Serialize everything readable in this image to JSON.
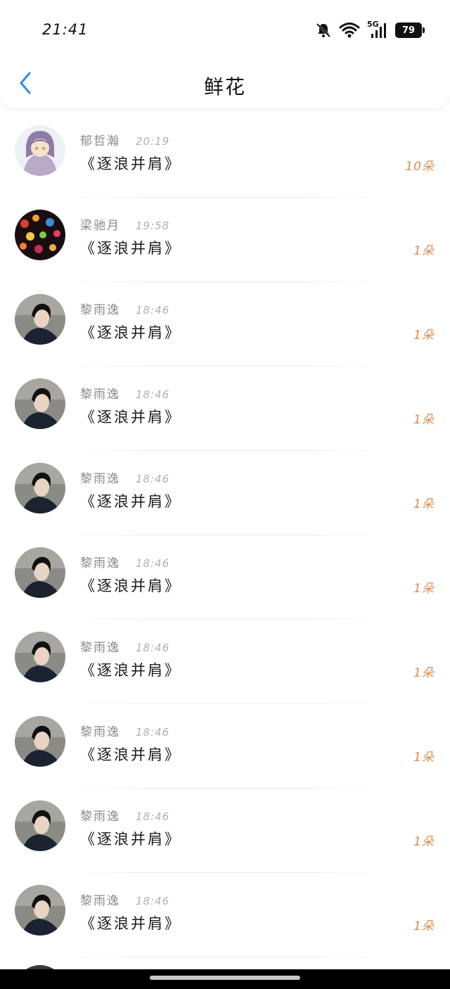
{
  "status_bar": {
    "time": "21:41",
    "network_label": "5G",
    "battery": "79"
  },
  "nav": {
    "title": "鲜花",
    "back_icon": "chevron-left-icon",
    "accent_color": "#2f8fe8"
  },
  "colors": {
    "count": "#e08a4d",
    "name": "#8a8a8a",
    "time": "#b0b0b0"
  },
  "list": [
    {
      "name": "郁哲瀚",
      "time": "20:19",
      "gift": "《逐浪并肩》",
      "count": "10朵",
      "avatar": "anime-hoodie"
    },
    {
      "name": "梁驰月",
      "time": "19:58",
      "gift": "《逐浪并肩》",
      "count": "1朵",
      "avatar": "bokeh-lights"
    },
    {
      "name": "黎雨逸",
      "time": "18:46",
      "gift": "《逐浪并肩》",
      "count": "1朵",
      "avatar": "boy-profile"
    },
    {
      "name": "黎雨逸",
      "time": "18:46",
      "gift": "《逐浪并肩》",
      "count": "1朵",
      "avatar": "boy-profile"
    },
    {
      "name": "黎雨逸",
      "time": "18:46",
      "gift": "《逐浪并肩》",
      "count": "1朵",
      "avatar": "boy-profile"
    },
    {
      "name": "黎雨逸",
      "time": "18:46",
      "gift": "《逐浪并肩》",
      "count": "1朵",
      "avatar": "boy-profile"
    },
    {
      "name": "黎雨逸",
      "time": "18:46",
      "gift": "《逐浪并肩》",
      "count": "1朵",
      "avatar": "boy-profile"
    },
    {
      "name": "黎雨逸",
      "time": "18:46",
      "gift": "《逐浪并肩》",
      "count": "1朵",
      "avatar": "boy-profile"
    },
    {
      "name": "黎雨逸",
      "time": "18:46",
      "gift": "《逐浪并肩》",
      "count": "1朵",
      "avatar": "boy-profile"
    },
    {
      "name": "黎雨逸",
      "time": "18:46",
      "gift": "《逐浪并肩》",
      "count": "1朵",
      "avatar": "boy-profile"
    }
  ]
}
